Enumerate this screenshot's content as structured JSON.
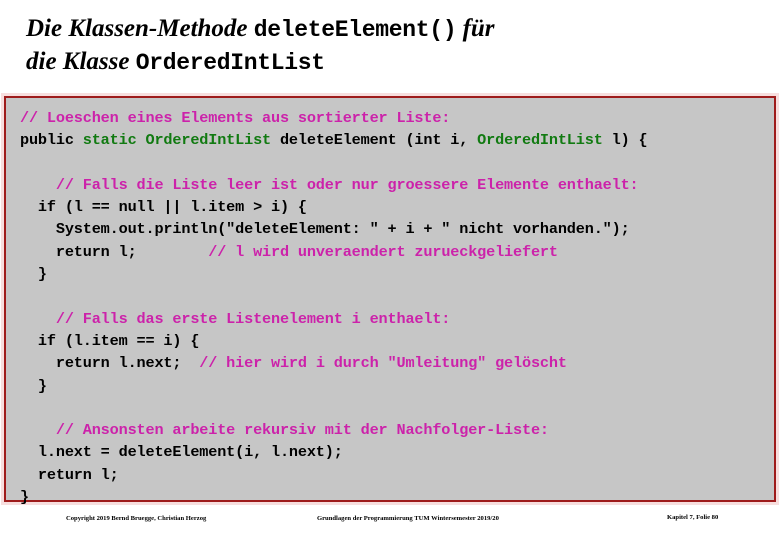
{
  "slide": {
    "title": {
      "line1_prefix": "Die Klassen-Methode ",
      "line1_code": "deleteElement()",
      "line1_suffix": " für",
      "line2_prefix": "die Klasse ",
      "line2_code": "OrderedIntList"
    },
    "code_panel": {
      "background_color": "#c6c6c6",
      "border_color": "#9e1b1b",
      "comment_color": "#cc22aa",
      "type_color": "#117a11",
      "plain_color": "#000000",
      "lines": [
        {
          "indent": 0,
          "segments": [
            {
              "kind": "comment",
              "text": "// Loeschen eines Elements aus sortierter Liste:"
            }
          ]
        },
        {
          "indent": 0,
          "segments": [
            {
              "kind": "plain",
              "text": "public "
            },
            {
              "kind": "type",
              "text": "static OrderedIntList"
            },
            {
              "kind": "plain",
              "text": " deleteElement (int i, "
            },
            {
              "kind": "type",
              "text": "OrderedIntList"
            },
            {
              "kind": "plain",
              "text": " l) {"
            }
          ]
        },
        {
          "indent": 0,
          "segments": []
        },
        {
          "indent": 2,
          "segments": [
            {
              "kind": "comment",
              "text": "// Falls die Liste leer ist oder nur groessere Elemente enthaelt:"
            }
          ]
        },
        {
          "indent": 1,
          "segments": [
            {
              "kind": "plain",
              "text": "if (l == null || l.item > i) {"
            }
          ]
        },
        {
          "indent": 2,
          "segments": [
            {
              "kind": "plain",
              "text": "System.out.println(\"deleteElement: \" + i + \" nicht vorhanden.\");"
            }
          ]
        },
        {
          "indent": 2,
          "segments": [
            {
              "kind": "plain",
              "text": "return l;        "
            },
            {
              "kind": "comment",
              "text": "// l wird unveraendert zurueckgeliefert"
            }
          ]
        },
        {
          "indent": 1,
          "segments": [
            {
              "kind": "plain",
              "text": "}"
            }
          ]
        },
        {
          "indent": 0,
          "segments": []
        },
        {
          "indent": 2,
          "segments": [
            {
              "kind": "comment",
              "text": "// Falls das erste Listenelement i enthaelt:"
            }
          ]
        },
        {
          "indent": 1,
          "segments": [
            {
              "kind": "plain",
              "text": "if (l.item == i) {"
            }
          ]
        },
        {
          "indent": 2,
          "segments": [
            {
              "kind": "plain",
              "text": "return l.next;  "
            },
            {
              "kind": "comment",
              "text": "// hier wird i durch \"Umleitung\" gelöscht"
            }
          ]
        },
        {
          "indent": 1,
          "segments": [
            {
              "kind": "plain",
              "text": "}"
            }
          ]
        },
        {
          "indent": 0,
          "segments": []
        },
        {
          "indent": 2,
          "segments": [
            {
              "kind": "comment",
              "text": "// Ansonsten arbeite rekursiv mit der Nachfolger-Liste:"
            }
          ]
        },
        {
          "indent": 1,
          "segments": [
            {
              "kind": "plain",
              "text": "l.next = deleteElement(i, l.next);"
            }
          ]
        },
        {
          "indent": 1,
          "segments": [
            {
              "kind": "plain",
              "text": "return l;"
            }
          ]
        },
        {
          "indent": 0,
          "segments": [
            {
              "kind": "plain",
              "text": "}"
            }
          ]
        }
      ]
    },
    "footer": {
      "left": "Copyright 2019 Bernd Bruegge, Christian Herzog",
      "center": "Grundlagen der Programmierung  TUM Wintersemester 2019/20",
      "right": "Kapitel 7, Folie 80"
    }
  }
}
